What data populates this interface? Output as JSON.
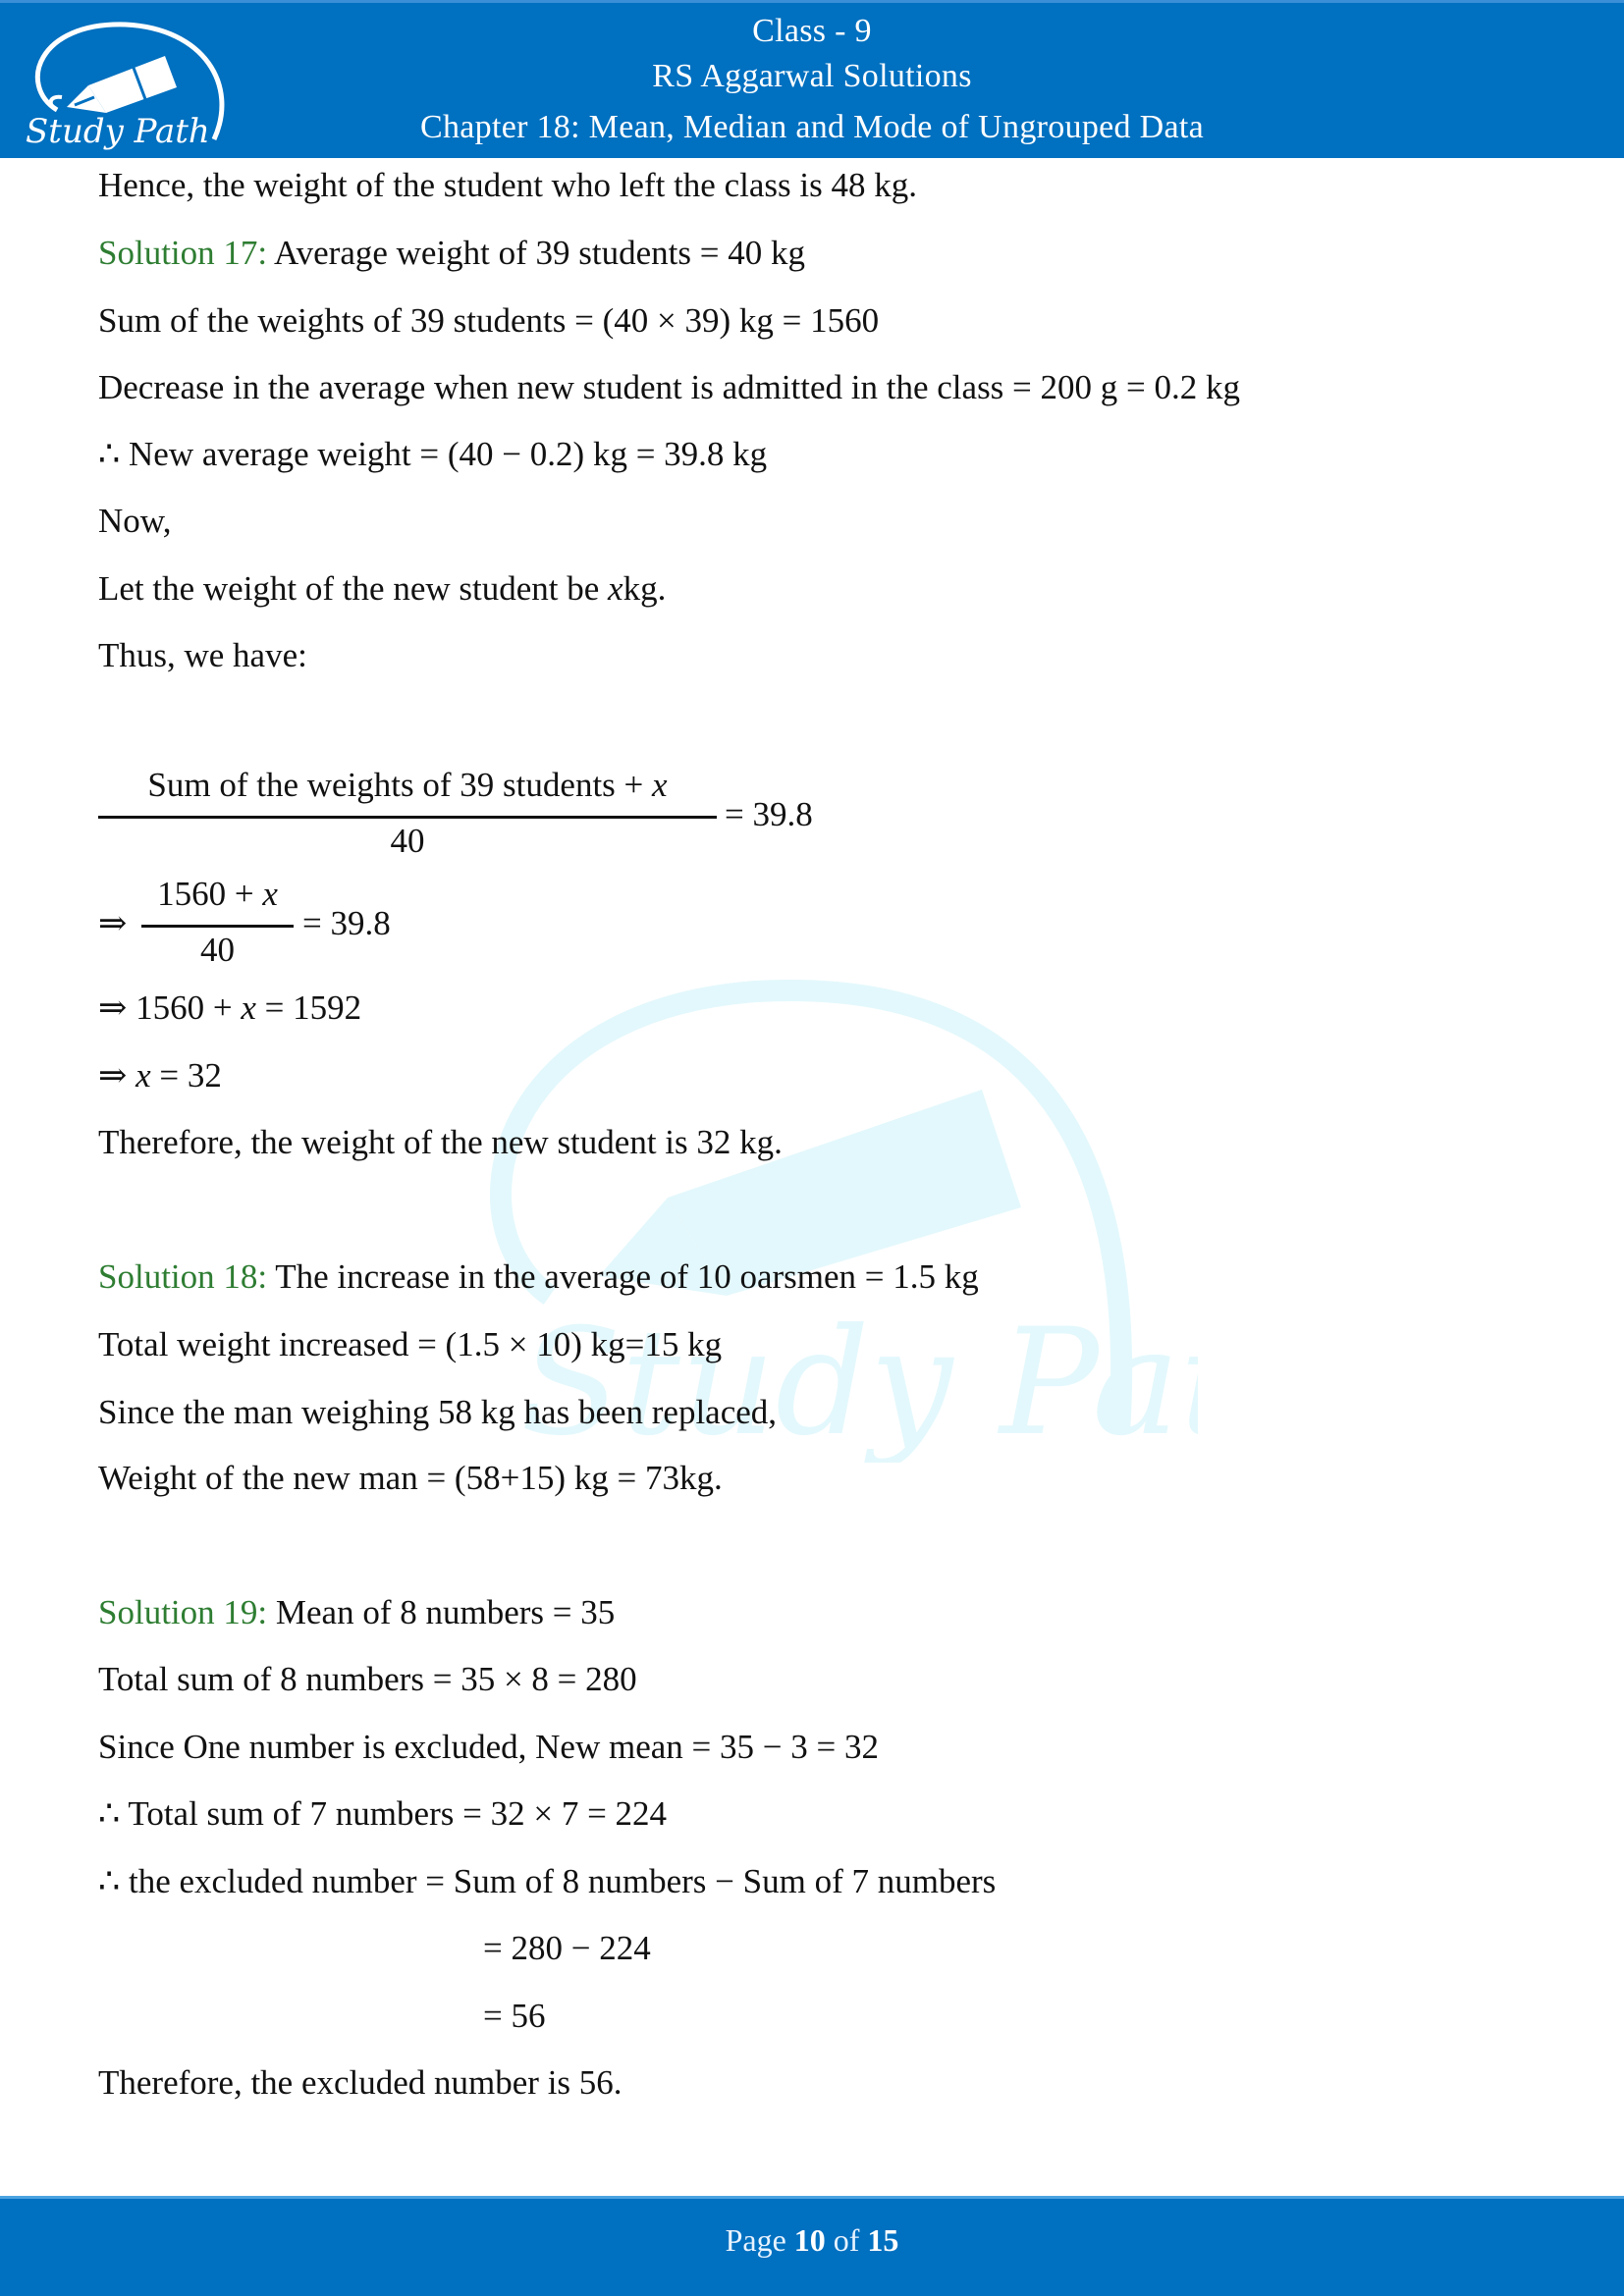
{
  "header": {
    "logo_text": "Study Path",
    "line1": "Class - 9",
    "line2": "RS Aggarwal Solutions",
    "line3": "Chapter 18: Mean, Median and Mode of Ungrouped Data"
  },
  "watermark": {
    "text": "Study Path"
  },
  "content": {
    "intro": "Hence, the weight of the student who left the class is 48 kg.",
    "sol17": {
      "label": "Solution 17:",
      "l1": "Average weight of 39 students = 40 kg",
      "l2": "Sum of the weights of 39 students = (40 × 39) kg = 1560",
      "l3": "Decrease in the average when new student is admitted in the class = 200 g = 0.2 kg",
      "l4": "∴ New average weight = (40 − 0.2) kg = 39.8 kg",
      "l5": "Now,",
      "l6_pre": "Let the weight of the new student be ",
      "l6_var": "x",
      "l6_post": "kg.",
      "l7": "Thus, we have:",
      "frac1_num_pre": "Sum of the weights of 39 students + ",
      "frac1_num_var": "x",
      "frac1_den": "40",
      "frac1_rhs": "= 39.8",
      "frac2_arrow": "⇒",
      "frac2_num_pre": "1560 + ",
      "frac2_num_var": "x",
      "frac2_den": "40",
      "frac2_rhs": "= 39.8",
      "step1_pre": "⇒ 1560 + ",
      "step1_var": "x",
      "step1_post": " = 1592",
      "step2_pre": "⇒ ",
      "step2_var": "x",
      "step2_post": " = 32",
      "conclusion": "Therefore, the weight of the new student is 32 kg."
    },
    "sol18": {
      "label": "Solution 18:",
      "l1": " The increase in the average of 10 oarsmen = 1.5 kg",
      "l2": "Total weight increased = (1.5 × 10) kg=15 kg",
      "l3": "Since the man weighing 58 kg has been replaced,",
      "l4": "Weight of the new man = (58+15) kg = 73kg."
    },
    "sol19": {
      "label": "Solution 19:",
      "l1": "Mean of 8 numbers = 35",
      "l2": "Total sum of 8 numbers = 35 × 8 = 280",
      "l3": " Since One number is excluded, New mean = 35 − 3 = 32",
      "l4": "∴ Total sum of 7 numbers = 32 × 7 = 224",
      "l5": "∴ the excluded number = Sum of 8 numbers − Sum of 7 numbers",
      "l6": "= 280 − 224",
      "l7": "= 56",
      "conclusion": "Therefore, the excluded number is 56."
    }
  },
  "footer": {
    "page_word": "Page",
    "current_page": "10",
    "of_word": "of",
    "total_pages": "15"
  },
  "colors": {
    "brand_blue": "#0070c0",
    "solution_green": "#2e7d32",
    "watermark_cyan": "#e3f8fc"
  }
}
